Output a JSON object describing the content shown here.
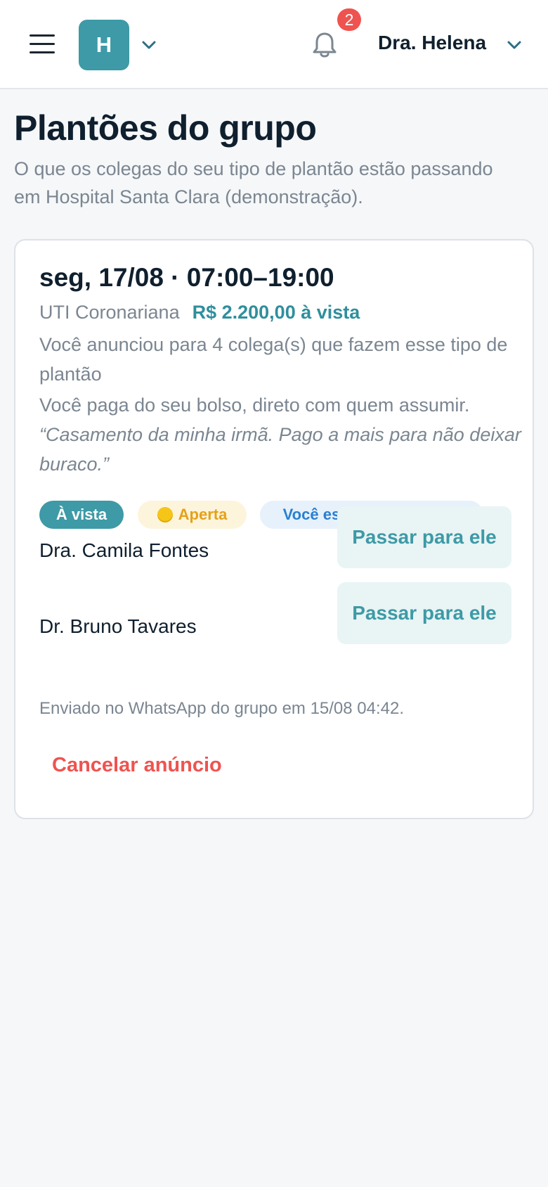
{
  "header": {
    "org_initial": "H",
    "notification_count": "2",
    "user_name": "Dra. Helena",
    "icons": [
      "menu-icon",
      "chevron-down-icon",
      "bell-icon"
    ]
  },
  "page": {
    "title": "Plantões do grupo",
    "subtitle": "O que os colegas do seu tipo de plantão estão passando em Hospital Santa Clara (demonstração)."
  },
  "shift": {
    "date_time": "seg, 17/08 · 07:00–19:00",
    "unit": "UTI Coronariana",
    "price": "R$ 2.200,00 à vista",
    "announced_to": "Você anunciou para 4 colega(s) que fazem esse tipo de plantão",
    "payment_note": "Você paga do seu bolso, direto com quem assumir.",
    "quote": "“Casamento da minha irmã. Pago a mais para não deixar buraco.”",
    "tags": {
      "vista": "À vista",
      "aperta": "Aperta",
      "escolhe": "Você escolhe quem leva"
    },
    "candidates": [
      {
        "name": "Dra. Camila Fontes",
        "button": "Passar para ele"
      },
      {
        "name": "Dr. Bruno Tavares",
        "button": "Passar para ele"
      }
    ],
    "sent_note": "Enviado no WhatsApp do grupo em 15/08 04:42.",
    "cancel_label": "Cancelar anúncio"
  },
  "colors": {
    "accent": "#3d9aa6",
    "danger": "#ef5350",
    "warning": "#e6a117",
    "info": "#2a7fd0"
  }
}
